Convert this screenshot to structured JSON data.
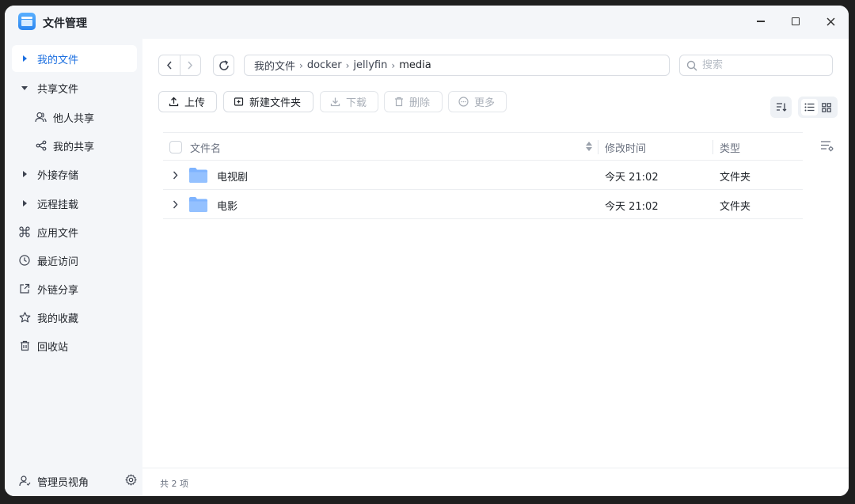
{
  "window": {
    "title": "文件管理"
  },
  "sidebar": {
    "items": [
      {
        "label": "我的文件",
        "icon": "caret-right-icon",
        "active": true
      },
      {
        "label": "共享文件",
        "icon": "caret-down-icon"
      },
      {
        "label": "他人共享",
        "icon": "users-icon",
        "sub": true
      },
      {
        "label": "我的共享",
        "icon": "share-icon",
        "sub": true
      },
      {
        "label": "外接存储",
        "icon": "caret-right-icon"
      },
      {
        "label": "远程挂载",
        "icon": "caret-right-icon"
      },
      {
        "label": "应用文件",
        "icon": "command-icon"
      },
      {
        "label": "最近访问",
        "icon": "clock-icon"
      },
      {
        "label": "外链分享",
        "icon": "external-link-icon"
      },
      {
        "label": "我的收藏",
        "icon": "star-icon"
      },
      {
        "label": "回收站",
        "icon": "trash-icon"
      }
    ],
    "footer": {
      "label": "管理员视角",
      "icon": "admin-user-icon",
      "settings_icon": "gear-icon"
    }
  },
  "breadcrumb": [
    "我的文件",
    "docker",
    "jellyfin",
    "media"
  ],
  "search": {
    "placeholder": "搜索",
    "value": ""
  },
  "toolbar": {
    "upload": "上传",
    "new_folder": "新建文件夹",
    "download": "下载",
    "delete": "删除",
    "more": "更多"
  },
  "table": {
    "columns": {
      "name": "文件名",
      "modified": "修改时间",
      "type": "类型"
    },
    "rows": [
      {
        "name": "电视剧",
        "modified": "今天 21:02",
        "type": "文件夹"
      },
      {
        "name": "电影",
        "modified": "今天 21:02",
        "type": "文件夹"
      }
    ]
  },
  "status": {
    "count": "共 2 项"
  },
  "colors": {
    "accent": "#1c6fe0",
    "folder": "#7fb4ff",
    "sidebar_bg": "#f4f6f9"
  }
}
